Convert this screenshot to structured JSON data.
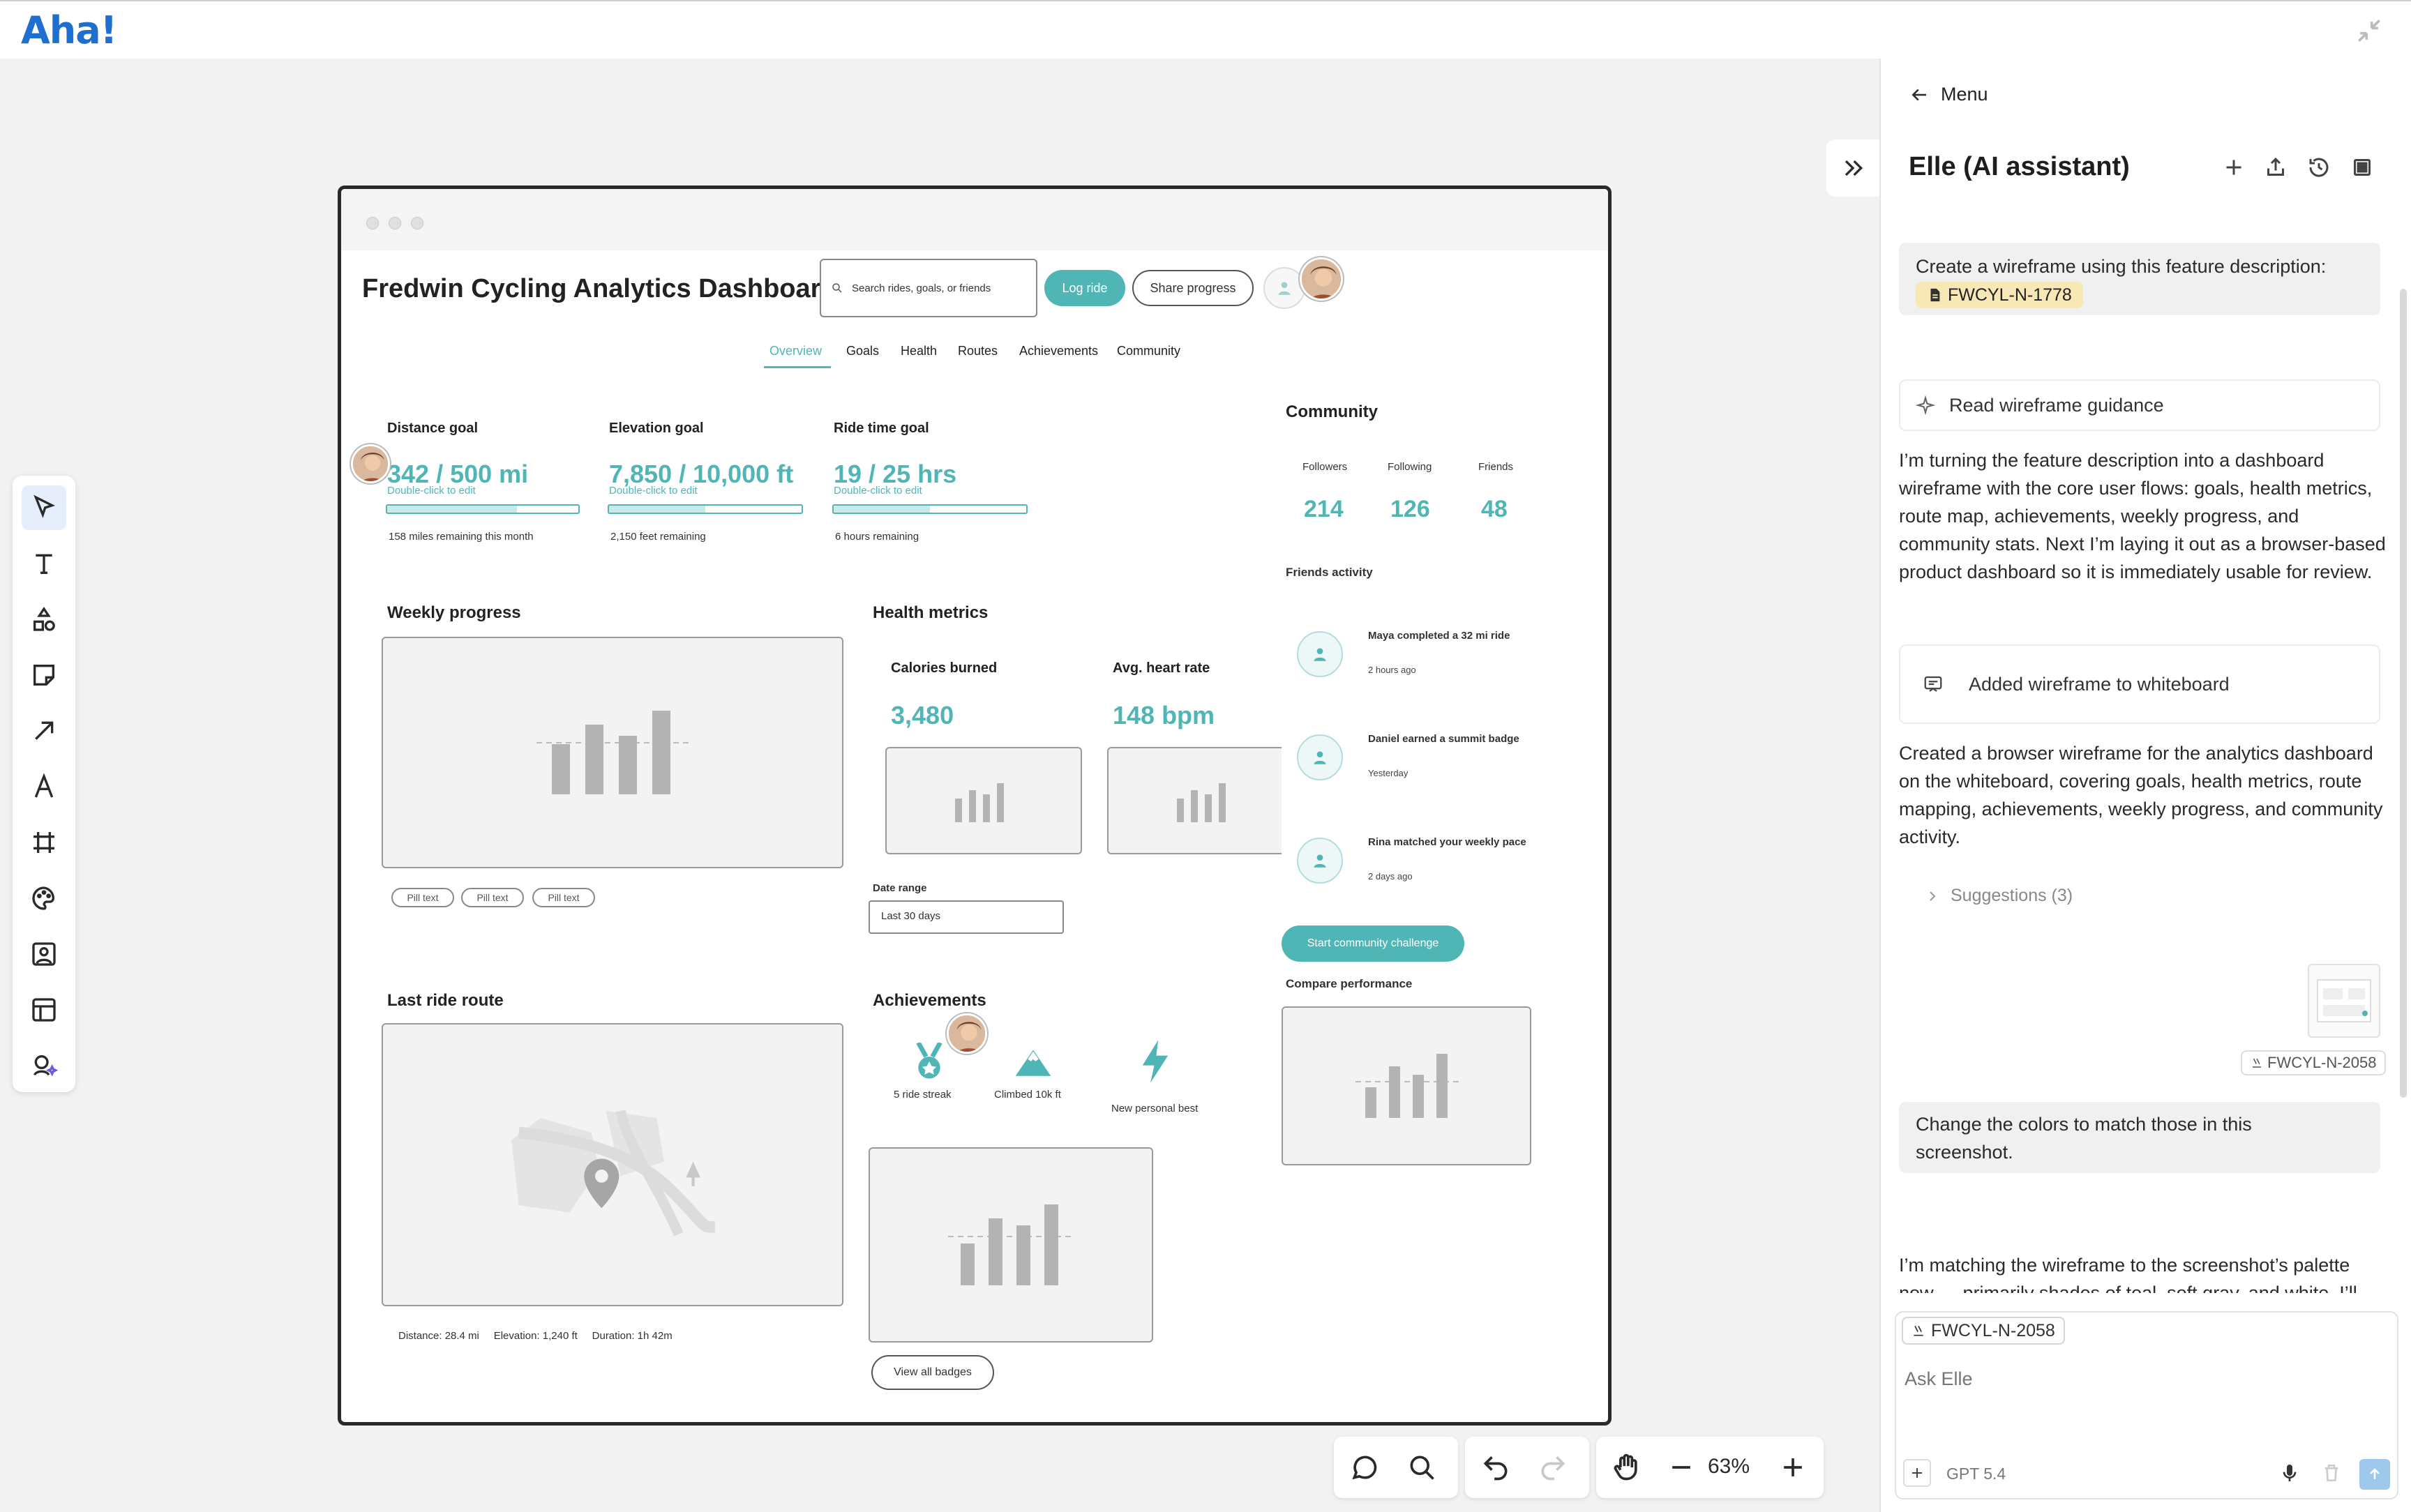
{
  "app": {
    "logo": "Aha!"
  },
  "wireframe": {
    "title": "Fredwin Cycling Analytics Dashboard",
    "search_placeholder": "Search rides, goals, or friends",
    "log_ride_label": "Log ride",
    "share_label": "Share progress",
    "tabs": [
      "Overview",
      "Goals",
      "Health",
      "Routes",
      "Achievements",
      "Community"
    ],
    "goals": [
      {
        "label": "Distance goal",
        "value": "342 / 500 mi",
        "hint": "Double-click to edit",
        "remaining": "158 miles remaining this month",
        "progress": 0.68
      },
      {
        "label": "Elevation goal",
        "value": "7,850 / 10,000 ft",
        "hint": "Double-click to edit",
        "remaining": "2,150 feet remaining",
        "progress": 0.5
      },
      {
        "label": "Ride time goal",
        "value": "19 / 25 hrs",
        "hint": "Double-click to edit",
        "remaining": "6 hours remaining",
        "progress": 0.5
      }
    ],
    "weekly_title": "Weekly progress",
    "pills": [
      "Pill text",
      "Pill text",
      "Pill text"
    ],
    "health_title": "Health metrics",
    "calories_label": "Calories burned",
    "calories_value": "3,480",
    "heart_label": "Avg. heart rate",
    "heart_value": "148 bpm",
    "date_range_label": "Date range",
    "date_range_value": "Last 30 days",
    "route_title": "Last ride route",
    "route_stats": "Distance: 28.4 mi     Elevation: 1,240 ft     Duration: 1h 42m",
    "achievements_title": "Achievements",
    "achievements": [
      "5 ride streak",
      "Climbed 10k ft",
      "New personal best"
    ],
    "view_badges_label": "View all badges",
    "community_title": "Community",
    "community_stats": [
      {
        "label": "Followers",
        "value": "214"
      },
      {
        "label": "Following",
        "value": "126"
      },
      {
        "label": "Friends",
        "value": "48"
      }
    ],
    "friends_title": "Friends activity",
    "friends": [
      {
        "text": "Maya completed a 32 mi ride",
        "time": "2 hours ago"
      },
      {
        "text": "Daniel earned a summit badge",
        "time": "Yesterday"
      },
      {
        "text": "Rina matched your weekly pace",
        "time": "2 days ago"
      }
    ],
    "challenge_label": "Start community challenge",
    "compare_title": "Compare performance"
  },
  "zoom": {
    "level": "63%"
  },
  "panel": {
    "menu_label": "Menu",
    "title": "Elle (AI assistant)",
    "msg1": "Create a wireframe using this feature description:",
    "msg1_tag": "FWCYL-N-1778",
    "guidance_label": "Read wireframe guidance",
    "reply1": "I’m turning the feature description into a dashboard wireframe with the core user flows: goals, health metrics, route map, achievements, weekly progress, and community stats. Next I’m laying it out as a browser-based product dashboard so it is immediately usable for review.",
    "added_label": "Added wireframe to whiteboard",
    "reply2": "Created a browser wireframe for the analytics dashboard on the whiteboard, covering goals, health metrics, route mapping, achievements, weekly progress, and community activity.",
    "suggestions_label": "Suggestions (3)",
    "attachment_tag": "FWCYL-N-2058",
    "msg2": "Change the colors to match those in this screenshot.",
    "reply3": "I’m matching the wireframe to the screenshot’s palette now — primarily shades of teal, soft gray, and white. I’ll",
    "input_chip": "FWCYL-N-2058",
    "input_placeholder": "Ask Elle",
    "model_label": "GPT 5.4"
  },
  "colors": {
    "accent_teal": "#4fb6b5",
    "brand_blue": "#1f6fd1"
  }
}
